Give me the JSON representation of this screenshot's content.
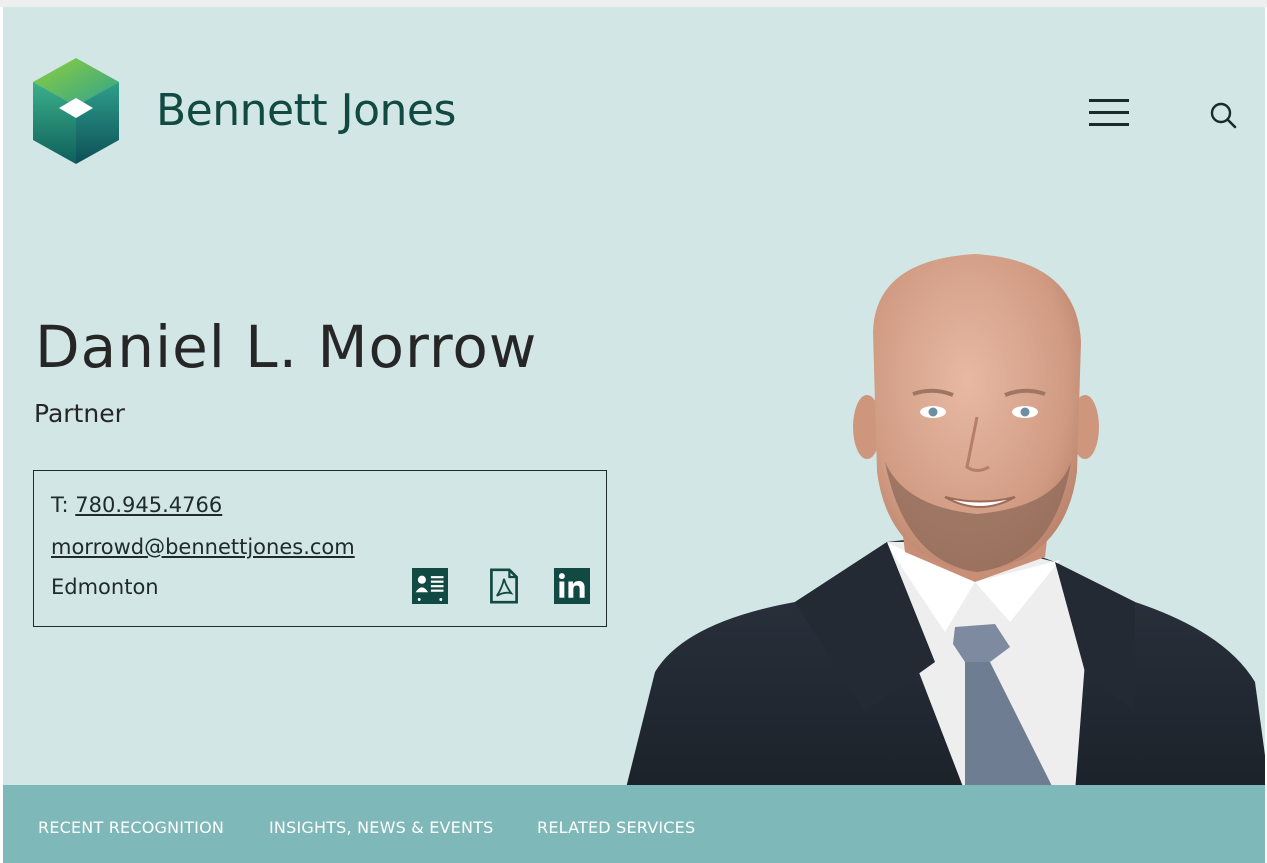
{
  "brand": {
    "name": "Bennett Jones",
    "color": "#114a43"
  },
  "header": {
    "menu_icon": "hamburger-menu-icon",
    "search_icon": "search-icon"
  },
  "profile": {
    "name": "Daniel L. Morrow",
    "title": "Partner",
    "phone_prefix": "T: ",
    "phone": "780.945.4766",
    "email": "morrowd@bennettjones.com",
    "location": "Edmonton",
    "icons": [
      "vcard-icon",
      "pdf-icon",
      "linkedin-icon"
    ]
  },
  "tabs": [
    {
      "label": "RECENT RECOGNITION"
    },
    {
      "label": "INSIGHTS, NEWS & EVENTS"
    },
    {
      "label": "RELATED SERVICES"
    }
  ],
  "colors": {
    "hero_bg": "#d2e6e5",
    "tabbar_bg": "#7fb8b9",
    "icon_dark": "#114a43"
  }
}
